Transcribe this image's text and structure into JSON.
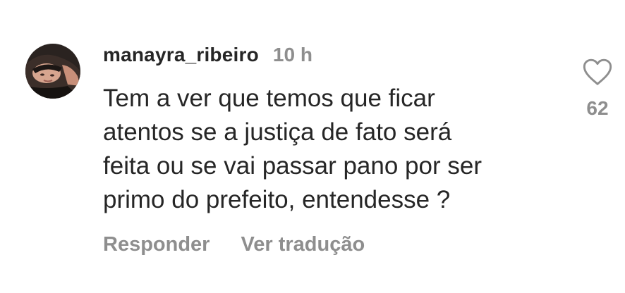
{
  "comment": {
    "username": "manayra_ribeiro",
    "time": "10 h",
    "text_lines": [
      "Tem a ver que temos que ficar",
      "atentos se a justiça de fato será",
      "feita ou se vai passar pano por ser",
      "primo do prefeito, entendesse ?"
    ],
    "actions": {
      "reply": "Responder",
      "translate": "Ver tradução"
    },
    "like": {
      "icon": "heart-outline-icon",
      "count": "62"
    }
  },
  "colors": {
    "primary_text": "#262626",
    "secondary_text": "#8e8e8e",
    "background": "#ffffff"
  }
}
